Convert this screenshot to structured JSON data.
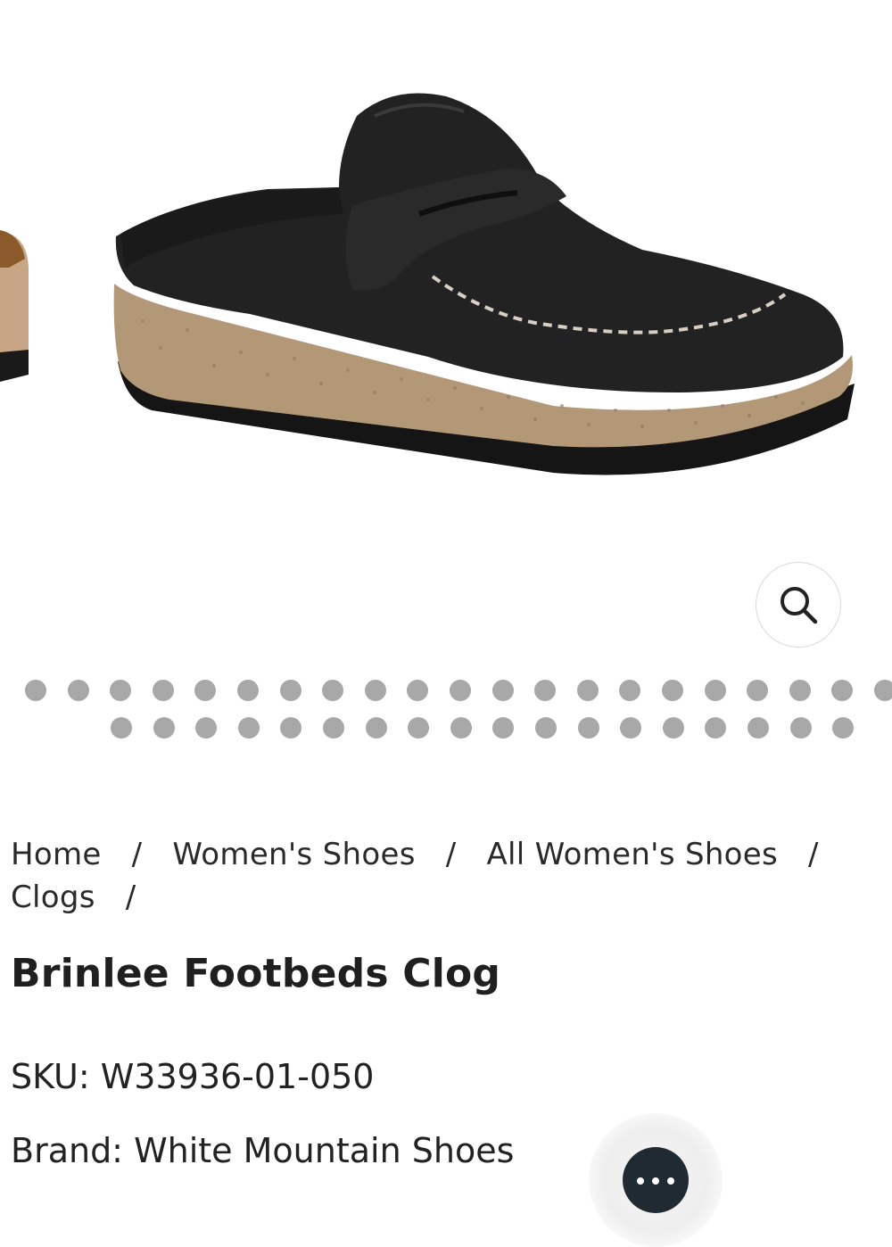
{
  "gallery": {
    "image_alt": "Black leather penny loafer clog with speckled cork wedge sole",
    "zoom_icon": "search-icon",
    "thumbnail_dots_row1": 21,
    "thumbnail_dots_row2": 18
  },
  "breadcrumb": {
    "items": [
      "Home",
      "Women's Shoes",
      "All Women's Shoes",
      "Clogs"
    ],
    "separator": "/"
  },
  "product": {
    "title": "Brinlee Footbeds Clog",
    "sku": "SKU: W33936-01-050",
    "brand": "Brand: White Mountain Shoes"
  },
  "chat": {
    "icon": "more-dots-icon"
  },
  "colors": {
    "dot": "#a8a8a8",
    "text": "#222222",
    "chat_button": "#1f2a33"
  }
}
